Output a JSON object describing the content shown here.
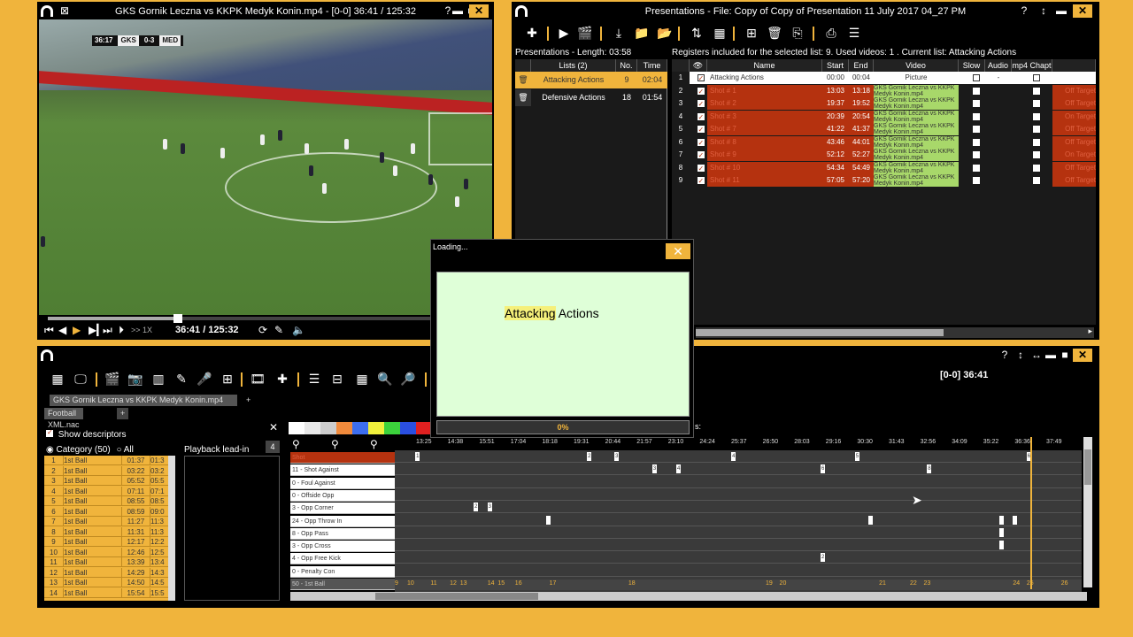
{
  "video_window": {
    "title": "GKS Gornik Leczna vs KKPK Medyk Konin.mp4 - [0-0]  36:41 / 125:32",
    "help": "?",
    "minimize": "▬",
    "maximize": "■",
    "close": "✕",
    "scoreboard": {
      "clock": "36:17",
      "home": "GKS",
      "score": "0-3",
      "away": "MED"
    },
    "time_readout": "36:41 / 125:32",
    "speed": ">> 1X",
    "progress_fraction": 0.3
  },
  "presentations_window": {
    "title": "Presentations - File: Copy of Copy of Presentation 11 July 2017 04_27 PM",
    "help": "?",
    "arrows": "↕",
    "minimize": "▬",
    "close": "✕",
    "length_label": "Presentations - Length: 03:58",
    "registers_info": "Registers included for the selected list: 9.  Used videos: 1 .  Current list: Attacking Actions",
    "lists_headers": [
      "Lists (2)",
      "No.",
      "Time"
    ],
    "lists": [
      {
        "name": "Attacking Actions",
        "no": "9",
        "time": "02:04"
      },
      {
        "name": "Defensive Actions",
        "no": "18",
        "time": "01:54"
      }
    ],
    "reg_headers": [
      "",
      "👁",
      "Name",
      "Start",
      "End",
      "Video",
      "Slow",
      "Audio",
      "mp4 Chapt"
    ],
    "registers": [
      {
        "n": "1",
        "name": "Attacking Actions",
        "start": "00:00",
        "end": "00:04",
        "video": "Picture",
        "audio": "-",
        "tag": ""
      },
      {
        "n": "2",
        "name": "Shot # 1",
        "start": "13:03",
        "end": "13:18",
        "video": "GKS Gornik Leczna vs KKPK Medyk Konin.mp4",
        "audio": "",
        "tag": "Off Target"
      },
      {
        "n": "3",
        "name": "Shot # 2",
        "start": "19:37",
        "end": "19:52",
        "video": "GKS Gornik Leczna vs KKPK Medyk Konin.mp4",
        "audio": "",
        "tag": "Off Target"
      },
      {
        "n": "4",
        "name": "Shot # 3",
        "start": "20:39",
        "end": "20:54",
        "video": "GKS Gornik Leczna vs KKPK Medyk Konin.mp4",
        "audio": "",
        "tag": "On Target"
      },
      {
        "n": "5",
        "name": "Shot # 7",
        "start": "41:22",
        "end": "41:37",
        "video": "GKS Gornik Leczna vs KKPK Medyk Konin.mp4",
        "audio": "",
        "tag": "Off Target"
      },
      {
        "n": "6",
        "name": "Shot # 8",
        "start": "43:46",
        "end": "44:01",
        "video": "GKS Gornik Leczna vs KKPK Medyk Konin.mp4",
        "audio": "",
        "tag": "Off Target"
      },
      {
        "n": "7",
        "name": "Shot # 9",
        "start": "52:12",
        "end": "52:27",
        "video": "GKS Gornik Leczna vs KKPK Medyk Konin.mp4",
        "audio": "",
        "tag": "On Target"
      },
      {
        "n": "8",
        "name": "Shot # 10",
        "start": "54:34",
        "end": "54:49",
        "video": "GKS Gornik Leczna vs KKPK Medyk Konin.mp4",
        "audio": "",
        "tag": "Off Target"
      },
      {
        "n": "9",
        "name": "Shot # 11",
        "start": "57:05",
        "end": "57:20",
        "video": "GKS Gornik Leczna vs KKPK Medyk Konin.mp4",
        "audio": "",
        "tag": "Off Target"
      }
    ]
  },
  "loading_dialog": {
    "title": "Loading...",
    "close": "✕",
    "text_highlight": "Attacking",
    "text_rest": " Actions",
    "progress": "0%"
  },
  "timeline_window": {
    "help": "?",
    "arrows": "↕",
    "hsize": "↔",
    "minimize": "▬",
    "maximize": "■",
    "close": "✕",
    "time": "[0-0]  36:41",
    "video_tab": "GKS Gornik Leczna vs KKPK Medyk Konin.mp4",
    "xml_tab": "Football XML.nac",
    "plus": "+",
    "show_descriptors": "Show descriptors",
    "category_label": "Category (50)",
    "all_label": "All",
    "playback_lead": "Playback lead-in",
    "lead_value": "4",
    "panel_close": "✕",
    "hidden_label": "s:",
    "categories": [
      {
        "n": "1",
        "name": "1st Ball",
        "t1": "01:37",
        "t2": "01:3"
      },
      {
        "n": "2",
        "name": "1st Ball",
        "t1": "03:22",
        "t2": "03:2"
      },
      {
        "n": "3",
        "name": "1st Ball",
        "t1": "05:52",
        "t2": "05:5"
      },
      {
        "n": "4",
        "name": "1st Ball",
        "t1": "07:11",
        "t2": "07:1"
      },
      {
        "n": "5",
        "name": "1st Ball",
        "t1": "08:55",
        "t2": "08:5"
      },
      {
        "n": "6",
        "name": "1st Ball",
        "t1": "08:59",
        "t2": "09:0"
      },
      {
        "n": "7",
        "name": "1st Ball",
        "t1": "11:27",
        "t2": "11:3"
      },
      {
        "n": "8",
        "name": "1st Ball",
        "t1": "11:31",
        "t2": "11:3"
      },
      {
        "n": "9",
        "name": "1st Ball",
        "t1": "12:17",
        "t2": "12:2"
      },
      {
        "n": "10",
        "name": "1st Ball",
        "t1": "12:46",
        "t2": "12:5"
      },
      {
        "n": "11",
        "name": "1st Ball",
        "t1": "13:39",
        "t2": "13:4"
      },
      {
        "n": "12",
        "name": "1st Ball",
        "t1": "14:29",
        "t2": "14:3"
      },
      {
        "n": "13",
        "name": "1st Ball",
        "t1": "14:50",
        "t2": "14:5"
      },
      {
        "n": "14",
        "name": "1st Ball",
        "t1": "15:54",
        "t2": "15:5"
      }
    ],
    "colors": [
      "#ffffff",
      "#e8e8e8",
      "#cccccc",
      "#f08a3c",
      "#3c6ef0",
      "#f0f03c",
      "#3cd23c",
      "#2a4fe0",
      "#e02020"
    ],
    "ruler": [
      "13:25",
      "14:38",
      "15:51",
      "17:04",
      "18:18",
      "19:31",
      "20:44",
      "21:57",
      "23:10",
      "24:24",
      "25:37",
      "26:50",
      "28:03",
      "29:16",
      "30:30",
      "31:43",
      "32:56",
      "34:09",
      "35:22",
      "36:36",
      "37:49"
    ],
    "tracks": [
      {
        "label": "Shot",
        "events": [
          {
            "p": 0.03,
            "n": "1"
          },
          {
            "p": 0.28,
            "n": "2"
          },
          {
            "p": 0.32,
            "n": "3"
          },
          {
            "p": 0.49,
            "n": "4"
          },
          {
            "p": 0.67,
            "n": "5"
          },
          {
            "p": 0.92,
            "n": "6"
          }
        ]
      },
      {
        "label": "11 - Shot Against",
        "events": [
          {
            "p": 0.375,
            "n": "3"
          },
          {
            "p": 0.41,
            "n": "4"
          },
          {
            "p": 0.62,
            "n": "6"
          },
          {
            "p": 0.775,
            "n": "8"
          }
        ]
      },
      {
        "label": "0 - Foul Against",
        "events": []
      },
      {
        "label": "0 - Offside Opp",
        "events": []
      },
      {
        "label": "3 - Opp Corner",
        "events": [
          {
            "p": 0.115,
            "n": "2"
          },
          {
            "p": 0.135,
            "n": "3"
          }
        ]
      },
      {
        "label": "24 - Opp Throw In",
        "events": [
          {
            "p": 0.22,
            "n": ""
          },
          {
            "p": 0.69,
            "n": ""
          },
          {
            "p": 0.88,
            "n": ""
          },
          {
            "p": 0.9,
            "n": ""
          }
        ]
      },
      {
        "label": "8 - Opp Pass",
        "events": [
          {
            "p": 0.88,
            "n": ""
          }
        ]
      },
      {
        "label": "3 - Opp Cross",
        "events": [
          {
            "p": 0.88,
            "n": ""
          }
        ]
      },
      {
        "label": "4 - Opp Free Kick",
        "events": [
          {
            "p": 0.62,
            "n": "2"
          }
        ]
      },
      {
        "label": "0 - Penalty Con",
        "events": []
      }
    ],
    "last_track": "50 - 1st Ball",
    "bottom_nums": [
      {
        "p": 0.0,
        "n": "9"
      },
      {
        "p": 0.018,
        "n": "10"
      },
      {
        "p": 0.052,
        "n": "11"
      },
      {
        "p": 0.08,
        "n": "12"
      },
      {
        "p": 0.095,
        "n": "13"
      },
      {
        "p": 0.135,
        "n": "14"
      },
      {
        "p": 0.15,
        "n": "15"
      },
      {
        "p": 0.175,
        "n": "16"
      },
      {
        "p": 0.225,
        "n": "17"
      },
      {
        "p": 0.34,
        "n": "18"
      },
      {
        "p": 0.54,
        "n": "19"
      },
      {
        "p": 0.56,
        "n": "20"
      },
      {
        "p": 0.705,
        "n": "21"
      },
      {
        "p": 0.75,
        "n": "22"
      },
      {
        "p": 0.77,
        "n": "23"
      },
      {
        "p": 0.9,
        "n": "24"
      },
      {
        "p": 0.92,
        "n": "25"
      },
      {
        "p": 0.97,
        "n": "26"
      }
    ],
    "playhead_fraction": 0.925
  }
}
